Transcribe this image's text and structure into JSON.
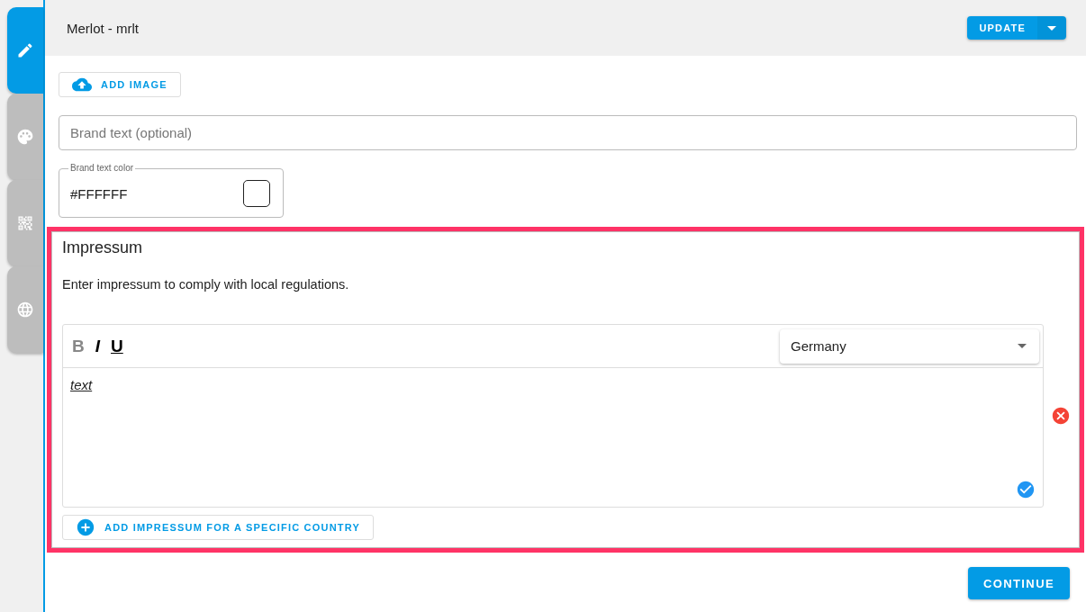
{
  "side_tabs": [
    {
      "kind": "edit",
      "selected": true
    },
    {
      "kind": "palette",
      "selected": false
    },
    {
      "kind": "qr",
      "selected": false
    },
    {
      "kind": "globe",
      "selected": false
    }
  ],
  "header": {
    "title": "Merlot - mrlt",
    "update_button": "UPDATE"
  },
  "add_image_button": "ADD IMAGE",
  "brand_text": {
    "placeholder": "Brand text (optional)"
  },
  "brand_text_color": {
    "label": "Brand text color",
    "value": "#FFFFFF"
  },
  "impressum": {
    "title": "Impressum",
    "description": "Enter impressum to comply with local regulations.",
    "editor": {
      "format_buttons": [
        {
          "kind": "bold",
          "label": "B",
          "active": false
        },
        {
          "kind": "italic",
          "label": "I",
          "active": true
        },
        {
          "kind": "underline",
          "label": "U",
          "active": true
        }
      ],
      "country": "Germany",
      "content": "text"
    },
    "add_country_button": "ADD IMPRESSUM FOR A SPECIFIC COUNTRY"
  },
  "continue_button": "CONTINUE"
}
